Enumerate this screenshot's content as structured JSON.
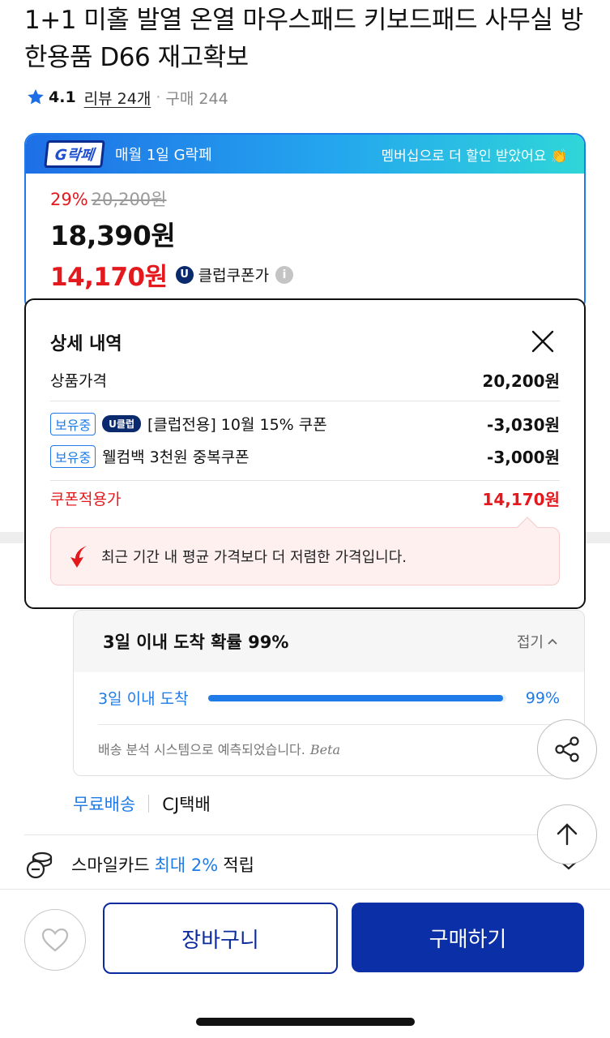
{
  "product": {
    "title": "1+1 미홀 발열 온열 마우스패드 키보드패드 사무실 방한용품 D66 재고확보",
    "rating": "4.1",
    "reviews": "리뷰 24개",
    "separator": "·",
    "purchases": "구매 244"
  },
  "promo": {
    "logo_text": "G락페",
    "banner_text": "매월 1일 G락페",
    "member_text": "멤버십으로 더 할인 받았어요 👏",
    "discount_pct": "29%",
    "original_price": "20,200원",
    "sale_price": "18,390원",
    "club_price": "14,170원",
    "club_badge": "U",
    "club_label": "클럽쿠폰가",
    "info_symbol": "i"
  },
  "popup": {
    "title": "상세 내역",
    "product_price_label": "상품가격",
    "product_price": "20,200원",
    "coupons": [
      {
        "owned": "보유중",
        "badge": "U클럽",
        "label": "[클럽전용] 10월 15% 쿠폰",
        "amount": "-3,030원"
      },
      {
        "owned": "보유중",
        "badge": "",
        "label": "웰컴백 3천원 중복쿠폰",
        "amount": "-3,000원"
      }
    ],
    "applied_label": "쿠폰적용가",
    "applied_price": "14,170원",
    "note": "최근 기간 내 평균 가격보다 더 저렴한 가격입니다."
  },
  "delivery": {
    "title": "3일 이내 도착 확률 99%",
    "fold": "접기",
    "prob_label": "3일 이내 도착",
    "prob_value": "99%",
    "prob_fraction": 0.99,
    "note": "배송 분석 시스템으로 예측되었습니다.",
    "note_beta": "Beta"
  },
  "shipping": {
    "free": "무료배송",
    "carrier": "CJ택배"
  },
  "card_benefit": {
    "prefix": "스마일카드",
    "highlight": "최대 2%",
    "suffix": "적립"
  },
  "actions": {
    "cart": "장바구니",
    "buy": "구매하기"
  },
  "colors": {
    "accent_blue": "#1e7be8",
    "sale_red": "#e4191e",
    "primary_navy": "#0a2fa6"
  }
}
